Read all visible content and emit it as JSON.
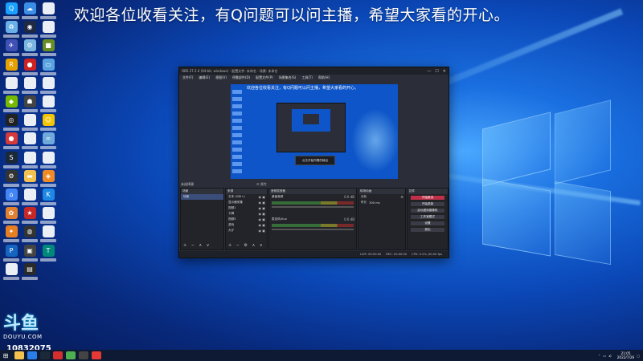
{
  "banner": "欢迎各位收看关注，有Q问题可以问主播，希望大家看的开心。",
  "stream": {
    "logo_big": "斗鱼",
    "logo_small": "DOUYU.COM",
    "room": "10832075"
  },
  "desktop_icons": [
    {
      "name": "qq-icon",
      "color": "#1aa0ff",
      "glyph": "Q"
    },
    {
      "name": "cloud-icon",
      "color": "#3a8ee6",
      "glyph": "☁"
    },
    {
      "name": "file-icon",
      "color": "#eaeef5",
      "glyph": ""
    },
    {
      "name": "recycle-bin-icon",
      "color": "#6ab0e8",
      "glyph": "♻"
    },
    {
      "name": "speedometer-icon",
      "color": "#1e2a44",
      "glyph": "◉"
    },
    {
      "name": "file-icon",
      "color": "#eaeef5",
      "glyph": ""
    },
    {
      "name": "bird-icon",
      "color": "#3f51b5",
      "glyph": "✈"
    },
    {
      "name": "gear-doc-icon",
      "color": "#7ab6e0",
      "glyph": "⚙"
    },
    {
      "name": "minecraft-icon",
      "color": "#6b8e23",
      "glyph": "■"
    },
    {
      "name": "rockstar-icon",
      "color": "#e5a100",
      "glyph": "R"
    },
    {
      "name": "game-icon",
      "color": "#cc2222",
      "glyph": "●"
    },
    {
      "name": "monitor-icon",
      "color": "#5aa3e0",
      "glyph": "▭"
    },
    {
      "name": "file-icon",
      "color": "#eaeef5",
      "glyph": ""
    },
    {
      "name": "file-icon",
      "color": "#eaeef5",
      "glyph": ""
    },
    {
      "name": "file-icon",
      "color": "#eaeef5",
      "glyph": ""
    },
    {
      "name": "nvidia-icon",
      "color": "#76b900",
      "glyph": "◆"
    },
    {
      "name": "helmet-icon",
      "color": "#444",
      "glyph": "☗"
    },
    {
      "name": "file-icon",
      "color": "#eaeef5",
      "glyph": ""
    },
    {
      "name": "obs-icon",
      "color": "#222",
      "glyph": "◎"
    },
    {
      "name": "file-icon",
      "color": "#eaeef5",
      "glyph": ""
    },
    {
      "name": "face-icon",
      "color": "#f5c400",
      "glyph": "☺"
    },
    {
      "name": "red-circle-icon",
      "color": "#d43a3a",
      "glyph": "●"
    },
    {
      "name": "file-icon",
      "color": "#eaeef5",
      "glyph": ""
    },
    {
      "name": "share-icon",
      "color": "#6fa8dc",
      "glyph": "∞"
    },
    {
      "name": "steam-icon",
      "color": "#1b2838",
      "glyph": "S"
    },
    {
      "name": "file-icon",
      "color": "#eaeef5",
      "glyph": ""
    },
    {
      "name": "file-icon",
      "color": "#eaeef5",
      "glyph": ""
    },
    {
      "name": "gear-circle-icon",
      "color": "#333",
      "glyph": "⚙"
    },
    {
      "name": "folder-icon",
      "color": "#f2c14e",
      "glyph": "▬"
    },
    {
      "name": "shield-icon",
      "color": "#f08a24",
      "glyph": "◈"
    },
    {
      "name": "app-icon",
      "color": "#4285f4",
      "glyph": "⌂"
    },
    {
      "name": "file-icon",
      "color": "#eaeef5",
      "glyph": ""
    },
    {
      "name": "k-icon",
      "color": "#1e88e5",
      "glyph": "K"
    },
    {
      "name": "cat-icon",
      "color": "#e08030",
      "glyph": "✿"
    },
    {
      "name": "red-app-icon",
      "color": "#c62828",
      "glyph": "★"
    },
    {
      "name": "file-icon",
      "color": "#eaeef5",
      "glyph": ""
    },
    {
      "name": "fox-icon",
      "color": "#e67e22",
      "glyph": "✦"
    },
    {
      "name": "globe-icon",
      "color": "#333",
      "glyph": "◍"
    },
    {
      "name": "file-icon",
      "color": "#eaeef5",
      "glyph": ""
    },
    {
      "name": "p-icon",
      "color": "#1565c0",
      "glyph": "P"
    },
    {
      "name": "photo-icon",
      "color": "#444",
      "glyph": "▣"
    },
    {
      "name": "tpm-icon",
      "color": "#00897b",
      "glyph": "T"
    },
    {
      "name": "file-icon",
      "color": "#eaeef5",
      "glyph": ""
    },
    {
      "name": "game-thumb-icon",
      "color": "#2a2a2a",
      "glyph": "▤"
    }
  ],
  "obs": {
    "title": "OBS 27.2.4 (64-bit, windows) - 配置文件: 未命名 - 场景: 未命名",
    "menu": [
      "文件(F)",
      "编辑(E)",
      "视图(V)",
      "停靠部件(D)",
      "配置文件(P)",
      "场景集合(S)",
      "工具(T)",
      "帮助(H)"
    ],
    "preview_banner": "欢迎各位收看关注，有Q问题可以问主播，希望大家看的开心。",
    "popup": "点击开始所需的输出",
    "preview_label": "未选择源",
    "preview_label2": "⚙ 属性",
    "scenes": {
      "header": "场景",
      "items": [
        "场景"
      ],
      "foot": "+ − ∧ ∨"
    },
    "sources": {
      "header": "来源",
      "items": [
        "文本 (GDI+)",
        "显示器采集",
        "视频1",
        "卡牌",
        "视频3",
        "游戏",
        "大厅"
      ],
      "foot": "+ − ⚙ ∧ ∨"
    },
    "mixer": {
      "header": "音频混音器",
      "tracks": [
        {
          "name": "桌面音频",
          "db": "0.0 dB"
        },
        {
          "name": "麦克风/Aux",
          "db": "0.0 dB"
        }
      ]
    },
    "transitions": {
      "header": "转场动画",
      "type": "淡化",
      "duration_label": "时长",
      "duration": "300 ms"
    },
    "controls": {
      "header": "控件",
      "buttons": [
        "开始推流",
        "开始录制",
        "启动虚拟摄像机",
        "工作室模式",
        "设置",
        "退出"
      ]
    },
    "status": [
      "LIVE: 00:00:00",
      "REC: 00:00:00",
      "CPU: 0.2%, 60.00 fps"
    ]
  },
  "taskbar": {
    "apps": [
      {
        "name": "taskbar-explorer-icon",
        "color": "#f2c14e"
      },
      {
        "name": "taskbar-edge-icon",
        "color": "#2b7de9"
      },
      {
        "name": "taskbar-steam-icon",
        "color": "#1b2838"
      },
      {
        "name": "taskbar-video-icon",
        "color": "#d32f2f"
      },
      {
        "name": "taskbar-app-icon",
        "color": "#4caf50"
      },
      {
        "name": "taskbar-obs-icon",
        "color": "#444"
      },
      {
        "name": "taskbar-red-icon",
        "color": "#e53935"
      }
    ],
    "time": "21:05",
    "date": "2022/7/26"
  }
}
